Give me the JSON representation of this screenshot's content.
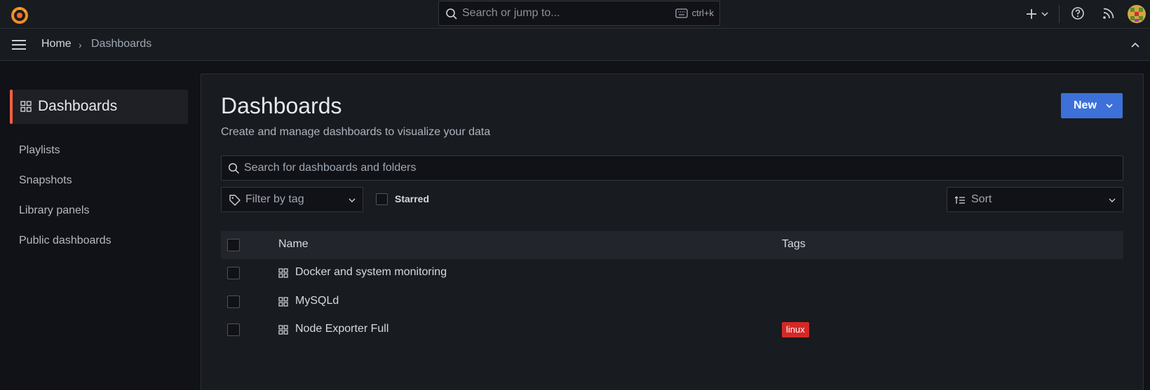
{
  "colors": {
    "accent": "#f55f3e",
    "primary": "#3d71d9",
    "tag_linux": "#d52828"
  },
  "topbar": {
    "search_placeholder": "Search or jump to...",
    "shortcut": "ctrl+k"
  },
  "breadcrumb": {
    "home": "Home",
    "separator": "›",
    "current": "Dashboards"
  },
  "sidebar": {
    "header": "Dashboards",
    "items": [
      {
        "label": "Playlists"
      },
      {
        "label": "Snapshots"
      },
      {
        "label": "Library panels"
      },
      {
        "label": "Public dashboards"
      }
    ]
  },
  "main": {
    "title": "Dashboards",
    "subtitle": "Create and manage dashboards to visualize your data",
    "new_button": "New",
    "search_placeholder": "Search for dashboards and folders",
    "tag_filter_placeholder": "Filter by tag",
    "starred_label": "Starred",
    "sort_placeholder": "Sort",
    "table": {
      "columns": [
        "Name",
        "Tags"
      ],
      "rows": [
        {
          "name": "Docker and system monitoring",
          "tags": []
        },
        {
          "name": "MySQLd",
          "tags": []
        },
        {
          "name": "Node Exporter Full",
          "tags": [
            "linux"
          ]
        }
      ]
    }
  }
}
